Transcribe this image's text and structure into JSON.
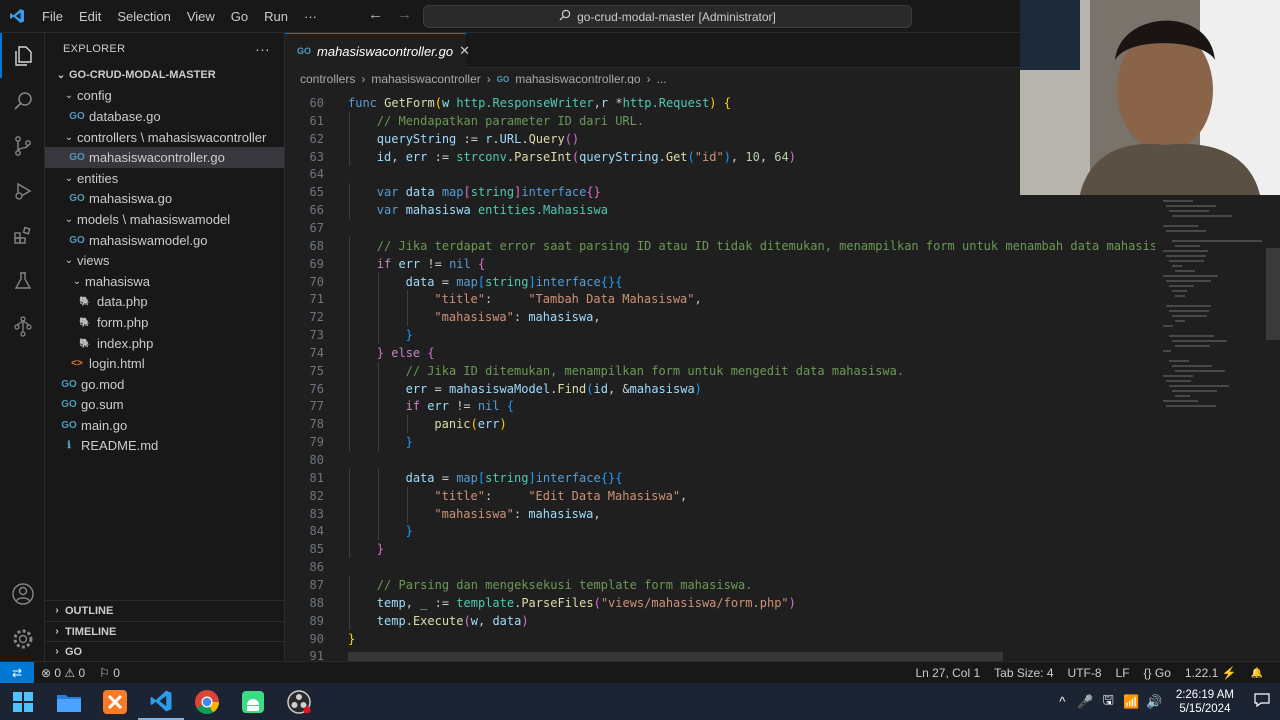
{
  "titlebar": {
    "menu": [
      "File",
      "Edit",
      "Selection",
      "View",
      "Go",
      "Run",
      "···"
    ],
    "command_center": "go-crud-modal-master [Administrator]"
  },
  "sidebar": {
    "title": "EXPLORER",
    "more": "···",
    "tree": [
      {
        "label": "GO-CRUD-MODAL-MASTER",
        "depth": 0,
        "kind": "root",
        "expanded": true
      },
      {
        "label": "config",
        "depth": 1,
        "kind": "folder",
        "expanded": true
      },
      {
        "label": "database.go",
        "depth": 2,
        "kind": "go"
      },
      {
        "label": "controllers \\ mahasiswacontroller",
        "depth": 1,
        "kind": "folder",
        "expanded": true
      },
      {
        "label": "mahasiswacontroller.go",
        "depth": 2,
        "kind": "go",
        "selected": true
      },
      {
        "label": "entities",
        "depth": 1,
        "kind": "folder",
        "expanded": true
      },
      {
        "label": "mahasiswa.go",
        "depth": 2,
        "kind": "go"
      },
      {
        "label": "models \\ mahasiswamodel",
        "depth": 1,
        "kind": "folder",
        "expanded": true
      },
      {
        "label": "mahasiswamodel.go",
        "depth": 2,
        "kind": "go"
      },
      {
        "label": "views",
        "depth": 1,
        "kind": "folder",
        "expanded": true
      },
      {
        "label": "mahasiswa",
        "depth": 2,
        "kind": "folder",
        "expanded": true
      },
      {
        "label": "data.php",
        "depth": 3,
        "kind": "php"
      },
      {
        "label": "form.php",
        "depth": 3,
        "kind": "php"
      },
      {
        "label": "index.php",
        "depth": 3,
        "kind": "php"
      },
      {
        "label": "login.html",
        "depth": 2,
        "kind": "html"
      },
      {
        "label": "go.mod",
        "depth": 1,
        "kind": "mod"
      },
      {
        "label": "go.sum",
        "depth": 1,
        "kind": "mod"
      },
      {
        "label": "main.go",
        "depth": 1,
        "kind": "go"
      },
      {
        "label": "README.md",
        "depth": 1,
        "kind": "md"
      }
    ],
    "sections": [
      "OUTLINE",
      "TIMELINE",
      "GO"
    ]
  },
  "editor": {
    "tab": "mahasiswacontroller.go",
    "breadcrumbs": [
      "controllers",
      "mahasiswacontroller",
      "mahasiswacontroller.go",
      "..."
    ],
    "lines": [
      {
        "n": "60",
        "indent": 0,
        "t": [
          [
            "kw",
            "func "
          ],
          [
            "fn",
            "GetForm"
          ],
          [
            "br1",
            "("
          ],
          [
            "var",
            "w "
          ],
          [
            "ty",
            "http.ResponseWriter"
          ],
          [
            "",
            ","
          ],
          [
            "var",
            "r "
          ],
          [
            "",
            "*"
          ],
          [
            "ty",
            "http.Request"
          ],
          [
            "br1",
            ")"
          ],
          [
            "",
            " "
          ],
          [
            "br1",
            "{"
          ]
        ]
      },
      {
        "n": "61",
        "indent": 1,
        "t": [
          [
            "cm",
            "// Mendapatkan parameter ID dari URL."
          ]
        ]
      },
      {
        "n": "62",
        "indent": 1,
        "t": [
          [
            "var",
            "queryString"
          ],
          [
            "",
            " := "
          ],
          [
            "var",
            "r"
          ],
          [
            "",
            "."
          ],
          [
            "var",
            "URL"
          ],
          [
            "",
            "."
          ],
          [
            "fn",
            "Query"
          ],
          [
            "br2",
            "()"
          ]
        ]
      },
      {
        "n": "63",
        "indent": 1,
        "t": [
          [
            "var",
            "id"
          ],
          [
            "",
            ", "
          ],
          [
            "var",
            "err"
          ],
          [
            "",
            " := "
          ],
          [
            "ty",
            "strconv"
          ],
          [
            "",
            "."
          ],
          [
            "fn",
            "ParseInt"
          ],
          [
            "br2",
            "("
          ],
          [
            "var",
            "queryString"
          ],
          [
            "",
            "."
          ],
          [
            "fn",
            "Get"
          ],
          [
            "br3",
            "("
          ],
          [
            "str",
            "\"id\""
          ],
          [
            "br3",
            ")"
          ],
          [
            "",
            ", "
          ],
          [
            "num",
            "10"
          ],
          [
            "",
            ", "
          ],
          [
            "num",
            "64"
          ],
          [
            "br2",
            ")"
          ]
        ]
      },
      {
        "n": "64",
        "indent": 0,
        "t": []
      },
      {
        "n": "65",
        "indent": 1,
        "t": [
          [
            "kw",
            "var "
          ],
          [
            "var",
            "data "
          ],
          [
            "kw",
            "map"
          ],
          [
            "br2",
            "["
          ],
          [
            "ty",
            "string"
          ],
          [
            "br2",
            "]"
          ],
          [
            "kw",
            "interface"
          ],
          [
            "br2",
            "{}"
          ]
        ]
      },
      {
        "n": "66",
        "indent": 1,
        "t": [
          [
            "kw",
            "var "
          ],
          [
            "var",
            "mahasiswa "
          ],
          [
            "ty",
            "entities.Mahasiswa"
          ]
        ]
      },
      {
        "n": "67",
        "indent": 0,
        "t": []
      },
      {
        "n": "68",
        "indent": 1,
        "t": [
          [
            "cm",
            "// Jika terdapat error saat parsing ID atau ID tidak ditemukan, menampilkan form untuk menambah data mahasis"
          ]
        ]
      },
      {
        "n": "69",
        "indent": 1,
        "t": [
          [
            "kw2",
            "if "
          ],
          [
            "var",
            "err"
          ],
          [
            "",
            " != "
          ],
          [
            "kw",
            "nil "
          ],
          [
            "br2",
            "{"
          ]
        ]
      },
      {
        "n": "70",
        "indent": 2,
        "t": [
          [
            "var",
            "data"
          ],
          [
            "",
            " = "
          ],
          [
            "kw",
            "map"
          ],
          [
            "br3",
            "["
          ],
          [
            "ty",
            "string"
          ],
          [
            "br3",
            "]"
          ],
          [
            "kw",
            "interface"
          ],
          [
            "br3",
            "{}"
          ],
          [
            "br3",
            "{"
          ]
        ]
      },
      {
        "n": "71",
        "indent": 3,
        "t": [
          [
            "str",
            "\"title\""
          ],
          [
            "",
            ":     "
          ],
          [
            "str",
            "\"Tambah Data Mahasiswa\""
          ],
          [
            "",
            ","
          ]
        ]
      },
      {
        "n": "72",
        "indent": 3,
        "t": [
          [
            "str",
            "\"mahasiswa\""
          ],
          [
            "",
            ": "
          ],
          [
            "var",
            "mahasiswa"
          ],
          [
            "",
            ","
          ]
        ]
      },
      {
        "n": "73",
        "indent": 2,
        "t": [
          [
            "br3",
            "}"
          ]
        ]
      },
      {
        "n": "74",
        "indent": 1,
        "t": [
          [
            "br2",
            "} "
          ],
          [
            "kw2",
            "else "
          ],
          [
            "br2",
            "{"
          ]
        ]
      },
      {
        "n": "75",
        "indent": 2,
        "t": [
          [
            "cm",
            "// Jika ID ditemukan, menampilkan form untuk mengedit data mahasiswa."
          ]
        ]
      },
      {
        "n": "76",
        "indent": 2,
        "t": [
          [
            "var",
            "err"
          ],
          [
            "",
            " = "
          ],
          [
            "var",
            "mahasiswaModel"
          ],
          [
            "",
            "."
          ],
          [
            "fn",
            "Find"
          ],
          [
            "br3",
            "("
          ],
          [
            "var",
            "id"
          ],
          [
            "",
            ", &"
          ],
          [
            "var",
            "mahasiswa"
          ],
          [
            "br3",
            ")"
          ]
        ]
      },
      {
        "n": "77",
        "indent": 2,
        "t": [
          [
            "kw2",
            "if "
          ],
          [
            "var",
            "err"
          ],
          [
            "",
            " != "
          ],
          [
            "kw",
            "nil "
          ],
          [
            "br3",
            "{"
          ]
        ]
      },
      {
        "n": "78",
        "indent": 3,
        "t": [
          [
            "fn",
            "panic"
          ],
          [
            "br1",
            "("
          ],
          [
            "var",
            "err"
          ],
          [
            "br1",
            ")"
          ]
        ]
      },
      {
        "n": "79",
        "indent": 2,
        "t": [
          [
            "br3",
            "}"
          ]
        ]
      },
      {
        "n": "80",
        "indent": 0,
        "t": []
      },
      {
        "n": "81",
        "indent": 2,
        "t": [
          [
            "var",
            "data"
          ],
          [
            "",
            " = "
          ],
          [
            "kw",
            "map"
          ],
          [
            "br3",
            "["
          ],
          [
            "ty",
            "string"
          ],
          [
            "br3",
            "]"
          ],
          [
            "kw",
            "interface"
          ],
          [
            "br3",
            "{}"
          ],
          [
            "br3",
            "{"
          ]
        ]
      },
      {
        "n": "82",
        "indent": 3,
        "t": [
          [
            "str",
            "\"title\""
          ],
          [
            "",
            ":     "
          ],
          [
            "str",
            "\"Edit Data Mahasiswa\""
          ],
          [
            "",
            ","
          ]
        ]
      },
      {
        "n": "83",
        "indent": 3,
        "t": [
          [
            "str",
            "\"mahasiswa\""
          ],
          [
            "",
            ": "
          ],
          [
            "var",
            "mahasiswa"
          ],
          [
            "",
            ","
          ]
        ]
      },
      {
        "n": "84",
        "indent": 2,
        "t": [
          [
            "br3",
            "}"
          ]
        ]
      },
      {
        "n": "85",
        "indent": 1,
        "t": [
          [
            "br2",
            "}"
          ]
        ]
      },
      {
        "n": "86",
        "indent": 0,
        "t": []
      },
      {
        "n": "87",
        "indent": 1,
        "t": [
          [
            "cm",
            "// Parsing dan mengeksekusi template form mahasiswa."
          ]
        ]
      },
      {
        "n": "88",
        "indent": 1,
        "t": [
          [
            "var",
            "temp"
          ],
          [
            "",
            ", "
          ],
          [
            "var",
            "_"
          ],
          [
            "",
            " := "
          ],
          [
            "ty",
            "template"
          ],
          [
            "",
            "."
          ],
          [
            "fn",
            "ParseFiles"
          ],
          [
            "br2",
            "("
          ],
          [
            "str",
            "\"views/mahasiswa/form.php\""
          ],
          [
            "br2",
            ")"
          ]
        ]
      },
      {
        "n": "89",
        "indent": 1,
        "t": [
          [
            "var",
            "temp"
          ],
          [
            "",
            "."
          ],
          [
            "fn",
            "Execute"
          ],
          [
            "br2",
            "("
          ],
          [
            "var",
            "w"
          ],
          [
            "",
            ", "
          ],
          [
            "var",
            "data"
          ],
          [
            "br2",
            ")"
          ]
        ]
      },
      {
        "n": "90",
        "indent": 0,
        "t": [
          [
            "br1",
            "}"
          ]
        ]
      },
      {
        "n": "91",
        "indent": 0,
        "t": []
      }
    ]
  },
  "statusbar": {
    "remote": "⇄",
    "errors": "⊗ 0 ⚠ 0",
    "ports": "⚐ 0",
    "position": "Ln 27, Col 1",
    "tab_size": "Tab Size: 4",
    "encoding": "UTF-8",
    "eol": "LF",
    "language": "{} Go",
    "go_version": "1.22.1 ⚡",
    "bell": "🔔"
  },
  "taskbar": {
    "time": "2:26:19 AM",
    "date": "5/15/2024",
    "tray_icons": [
      "^",
      "🎤",
      "🖫",
      "📶",
      "🔊"
    ]
  },
  "colors": {
    "accent": "#0078d4",
    "editor_bg": "#1f1f1f",
    "sidebar_bg": "#181818",
    "taskbar_bg": "#1c2333"
  }
}
